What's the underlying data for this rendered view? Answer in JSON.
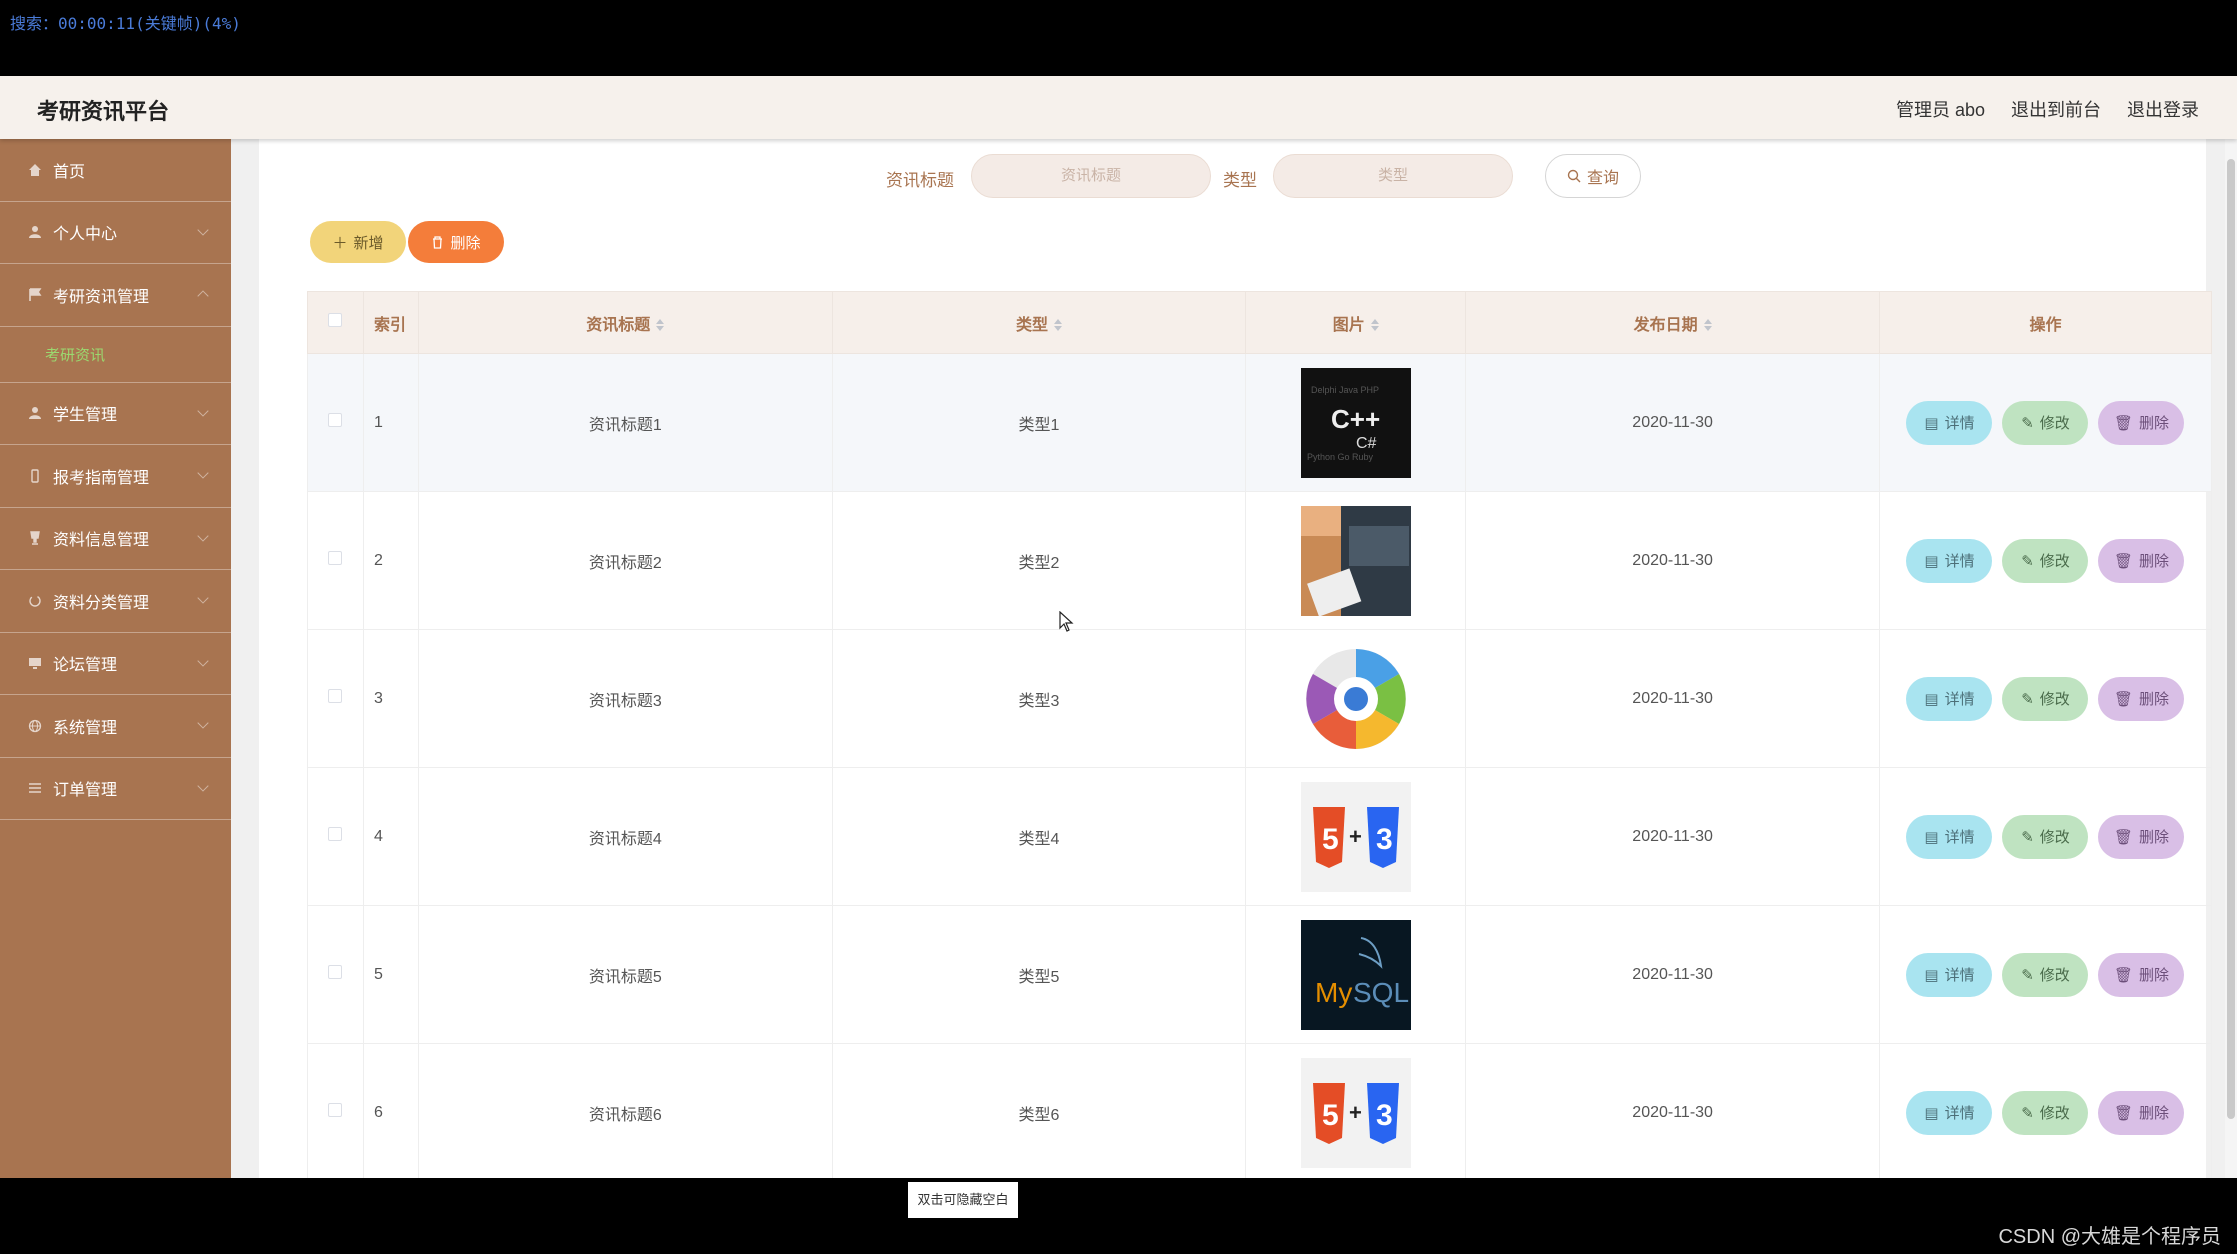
{
  "video": {
    "status_text": "搜索：00:00:11(关键帧)(4%)",
    "hide_blank_label": "双击可隐藏空白",
    "watermark": "CSDN @大雄是个程序员"
  },
  "header": {
    "brand": "考研资讯平台",
    "user": "管理员 abo",
    "front_link": "退出到前台",
    "logout_link": "退出登录"
  },
  "sidebar": {
    "items": [
      {
        "label": "首页",
        "icon": "home-icon"
      },
      {
        "label": "个人中心",
        "icon": "user-icon"
      },
      {
        "label": "考研资讯管理",
        "icon": "flag-icon"
      },
      {
        "label": "学生管理",
        "icon": "user-icon"
      },
      {
        "label": "报考指南管理",
        "icon": "phone-icon"
      },
      {
        "label": "资料信息管理",
        "icon": "trophy-icon"
      },
      {
        "label": "资料分类管理",
        "icon": "loading-icon"
      },
      {
        "label": "论坛管理",
        "icon": "monitor-icon"
      },
      {
        "label": "系统管理",
        "icon": "globe-icon"
      },
      {
        "label": "订单管理",
        "icon": "list-icon"
      }
    ],
    "subitem": "考研资讯"
  },
  "search": {
    "title_label": "资讯标题",
    "title_placeholder": "资讯标题",
    "type_label": "类型",
    "type_placeholder": "类型",
    "query_label": "查询"
  },
  "actions": {
    "add_label": "新增",
    "delete_label": "删除"
  },
  "table": {
    "headers": {
      "index": "索引",
      "title": "资讯标题",
      "type": "类型",
      "image": "图片",
      "date": "发布日期",
      "ops": "操作"
    },
    "rows": [
      {
        "index": "1",
        "title": "资讯标题1",
        "type": "类型1",
        "image": "cpp-wordcloud-image",
        "date": "2020-11-30"
      },
      {
        "index": "2",
        "title": "资讯标题2",
        "type": "类型2",
        "image": "laptop-desk-image",
        "date": "2020-11-30"
      },
      {
        "index": "3",
        "title": "资讯标题3",
        "type": "类型3",
        "image": "web-tech-wheel-image",
        "date": "2020-11-30"
      },
      {
        "index": "4",
        "title": "资讯标题4",
        "type": "类型4",
        "image": "html5-css3-image",
        "date": "2020-11-30"
      },
      {
        "index": "5",
        "title": "资讯标题5",
        "type": "类型5",
        "image": "mysql-logo-image",
        "date": "2020-11-30"
      },
      {
        "index": "6",
        "title": "资讯标题6",
        "type": "类型6",
        "image": "html5-css3-image",
        "date": "2020-11-30"
      }
    ],
    "op_labels": {
      "detail": "详情",
      "edit": "修改",
      "delete": "删除"
    }
  },
  "images": {
    "cpp_text": "C++",
    "csharp_text": "C#",
    "mysql_text": "MySQL",
    "html_badge": "5",
    "css_badge": "3",
    "plus": "+"
  },
  "colors": {
    "sidebar": "#a87450",
    "header": "#f6f1ec",
    "accent": "#a87450",
    "submenu_active": "#9bd86f"
  }
}
